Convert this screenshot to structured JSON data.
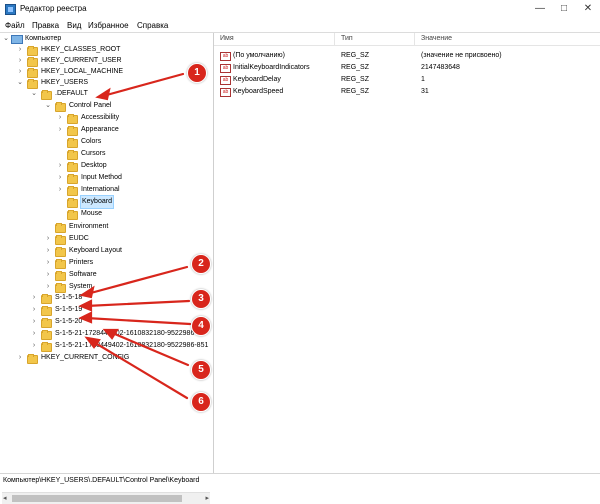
{
  "window": {
    "title": "Редактор реестра",
    "controls": {
      "minimize": "—",
      "maximize": "□",
      "close": "✕"
    }
  },
  "menu": [
    "Файл",
    "Правка",
    "Вид",
    "Избранное",
    "Справка"
  ],
  "tree": {
    "root": "Компьютер",
    "items": [
      {
        "label": "HKEY_CLASSES_ROOT",
        "expander": "›"
      },
      {
        "label": "HKEY_CURRENT_USER",
        "expander": "›"
      },
      {
        "label": "HKEY_LOCAL_MACHINE",
        "expander": "›"
      },
      {
        "label": "HKEY_USERS",
        "expander": "⌄"
      },
      {
        "label": ".DEFAULT",
        "expander": "⌄"
      },
      {
        "label": "Control Panel",
        "expander": "⌄"
      },
      {
        "label": "Accessibility",
        "expander": "›"
      },
      {
        "label": "Appearance",
        "expander": "›"
      },
      {
        "label": "Colors",
        "expander": ""
      },
      {
        "label": "Cursors",
        "expander": ""
      },
      {
        "label": "Desktop",
        "expander": "›"
      },
      {
        "label": "Input Method",
        "expander": "›"
      },
      {
        "label": "International",
        "expander": "›"
      },
      {
        "label": "Keyboard",
        "expander": ""
      },
      {
        "label": "Mouse",
        "expander": ""
      },
      {
        "label": "Environment",
        "expander": ""
      },
      {
        "label": "EUDC",
        "expander": "›"
      },
      {
        "label": "Keyboard Layout",
        "expander": "›"
      },
      {
        "label": "Printers",
        "expander": "›"
      },
      {
        "label": "Software",
        "expander": "›"
      },
      {
        "label": "System",
        "expander": "›"
      },
      {
        "label": "S-1-5-18",
        "expander": "›"
      },
      {
        "label": "S-1-5-19",
        "expander": "›"
      },
      {
        "label": "S-1-5-20",
        "expander": "›"
      },
      {
        "label": "S-1-5-21-1728449402-1610832180-9522986-",
        "expander": "›"
      },
      {
        "label": "S-1-5-21-1728449402-1610832180-9522986-851",
        "expander": "›"
      },
      {
        "label": "HKEY_CURRENT_CONFIG",
        "expander": "›"
      }
    ]
  },
  "list": {
    "headers": {
      "name": "Имя",
      "type": "Тип",
      "value": "Значение"
    },
    "rows": [
      {
        "icon": "ab",
        "name": "(По умолчанию)",
        "type": "REG_SZ",
        "value": "(значение не присвоено)"
      },
      {
        "icon": "ab",
        "name": "InitialKeyboardIndicators",
        "type": "REG_SZ",
        "value": "2147483648"
      },
      {
        "icon": "ab",
        "name": "KeyboardDelay",
        "type": "REG_SZ",
        "value": "1"
      },
      {
        "icon": "ab",
        "name": "KeyboardSpeed",
        "type": "REG_SZ",
        "value": "31"
      }
    ]
  },
  "status": {
    "path": "Компьютер\\HKEY_USERS\\.DEFAULT\\Control Panel\\Keyboard"
  },
  "annotations": {
    "badges": [
      "1",
      "2",
      "3",
      "4",
      "5",
      "6"
    ],
    "color": "#d8261c"
  },
  "colors": {
    "selection": "#cce8ff",
    "folder": "#f2c64a",
    "accent": "#2b78c2"
  }
}
